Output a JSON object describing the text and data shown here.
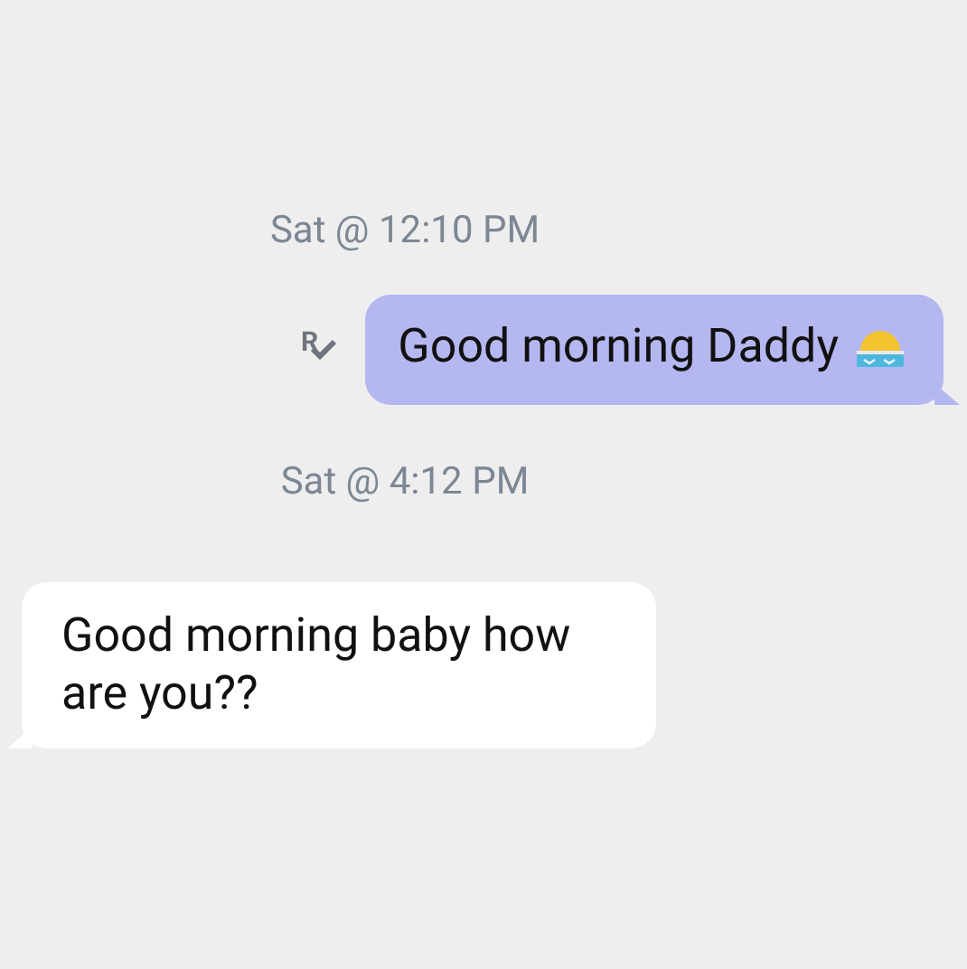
{
  "messages": [
    {
      "kind": "timestamp",
      "text": "Sat @ 12:10 PM"
    },
    {
      "kind": "sent",
      "text": "Good morning Daddy",
      "trailing_icon": true,
      "read": true,
      "receipt_label": "R"
    },
    {
      "kind": "timestamp",
      "text": "Sat @ 4:12 PM"
    },
    {
      "kind": "received",
      "text": "Good morning baby how are you??"
    }
  ]
}
